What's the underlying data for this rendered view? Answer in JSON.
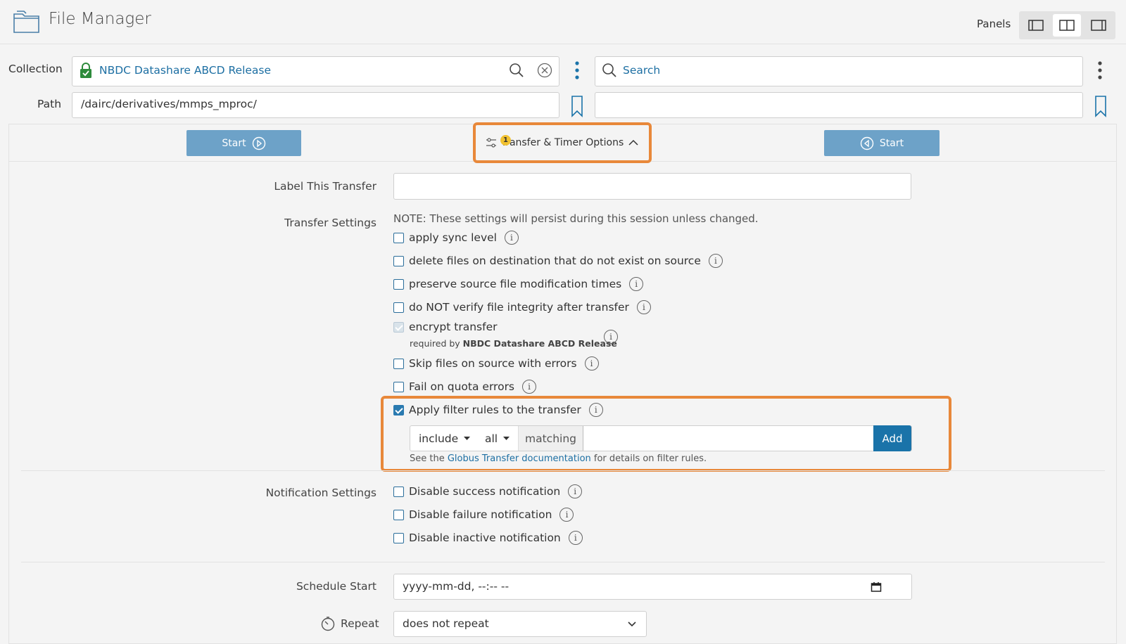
{
  "app": {
    "title": "File Manager"
  },
  "panels": {
    "label": "Panels",
    "options": [
      "single-panel",
      "dual-panel",
      "right-panel"
    ],
    "active": "dual-panel"
  },
  "left": {
    "collection_label": "Collection",
    "collection_name": "NBDC Datashare ABCD Release",
    "path_label": "Path",
    "path_value": "/dairc/derivatives/mmps_mproc/",
    "start_label": "Start"
  },
  "right": {
    "search_placeholder": "Search",
    "path_value": "",
    "start_label": "Start"
  },
  "options": {
    "toggle_label": "Transfer & Timer Options",
    "badge_count": "1"
  },
  "form": {
    "label_this_transfer": "Label This Transfer",
    "label_value": "",
    "transfer_settings": "Transfer Settings",
    "note": "NOTE: These settings will persist during this session unless changed.",
    "settings": {
      "sync": "apply sync level",
      "delete": "delete files on destination that do not exist on source",
      "preserve": "preserve source file modification times",
      "verify": "do NOT verify file integrity after transfer",
      "encrypt": "encrypt transfer",
      "encrypt_required_prefix": "required by",
      "encrypt_required_by": "NBDC Datashare ABCD Release",
      "skip": "Skip files on source with errors",
      "quota": "Fail on quota errors",
      "filter": "Apply filter rules to the transfer"
    },
    "filter": {
      "mode": "include",
      "scope": "all",
      "matching": "matching",
      "pattern": "",
      "add_label": "Add",
      "help_prefix": "See the",
      "help_link": "Globus Transfer documentation",
      "help_suffix": "for details on filter rules."
    },
    "notification_settings": "Notification Settings",
    "notifications": {
      "success": "Disable success notification",
      "failure": "Disable failure notification",
      "inactive": "Disable inactive notification"
    },
    "schedule_start": "Schedule Start",
    "schedule_placeholder": "yyyy-mm-dd, --:-- --",
    "repeat_label": "Repeat",
    "repeat_value": "does not repeat"
  },
  "colors": {
    "accent": "#1a73a9",
    "start_button": "#6da2c8",
    "highlight": "#e8883a",
    "badge": "#f2c230"
  }
}
